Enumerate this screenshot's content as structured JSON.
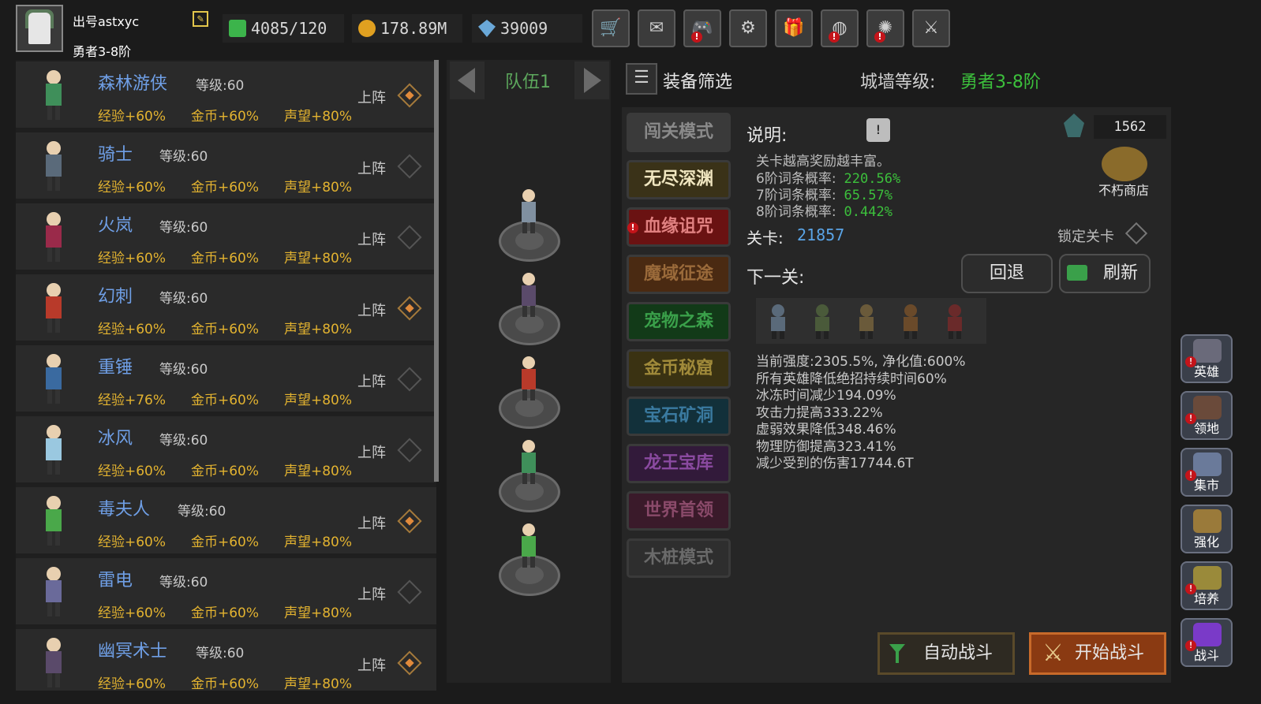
{
  "player": {
    "name": "出号astxyc",
    "rank": "勇者3-8阶"
  },
  "resources": {
    "stamina": "4085/120",
    "gold": "178.89M",
    "diamond": "39009"
  },
  "toolbar": [
    {
      "icon": "shop-cart-icon",
      "glyph": "🛒",
      "alert": false
    },
    {
      "icon": "mail-icon",
      "glyph": "✉",
      "alert": false
    },
    {
      "icon": "gamepad-icon",
      "glyph": "🎮",
      "alert": true
    },
    {
      "icon": "gear-icon",
      "glyph": "⚙",
      "alert": false
    },
    {
      "icon": "gift-icon",
      "glyph": "🎁",
      "alert": false
    },
    {
      "icon": "lottery-wheel-icon",
      "glyph": "◍",
      "alert": true
    },
    {
      "icon": "firework-icon",
      "glyph": "✺",
      "alert": true
    },
    {
      "icon": "crossed-swords-icon",
      "glyph": "⚔",
      "alert": false
    }
  ],
  "heroes": [
    {
      "name": "森林游侠",
      "level": "等级:60",
      "exp": "经验+60%",
      "gold": "金币+60%",
      "fame": "声望+80%",
      "deploy": "上阵",
      "deployed": true,
      "color": "#3f8f5a"
    },
    {
      "name": "骑士",
      "level": "等级:60",
      "exp": "经验+60%",
      "gold": "金币+60%",
      "fame": "声望+80%",
      "deploy": "上阵",
      "deployed": false,
      "color": "#5a6a7a"
    },
    {
      "name": "火岚",
      "level": "等级:60",
      "exp": "经验+60%",
      "gold": "金币+60%",
      "fame": "声望+80%",
      "deploy": "上阵",
      "deployed": false,
      "color": "#9a2a4a"
    },
    {
      "name": "幻刺",
      "level": "等级:60",
      "exp": "经验+60%",
      "gold": "金币+60%",
      "fame": "声望+80%",
      "deploy": "上阵",
      "deployed": true,
      "color": "#b83a2a"
    },
    {
      "name": "重锤",
      "level": "等级:60",
      "exp": "经验+76%",
      "gold": "金币+60%",
      "fame": "声望+80%",
      "deploy": "上阵",
      "deployed": false,
      "color": "#3a6aa0"
    },
    {
      "name": "冰风",
      "level": "等级:60",
      "exp": "经验+60%",
      "gold": "金币+60%",
      "fame": "声望+80%",
      "deploy": "上阵",
      "deployed": false,
      "color": "#9ac8e0"
    },
    {
      "name": "毒夫人",
      "level": "等级:60",
      "exp": "经验+60%",
      "gold": "金币+60%",
      "fame": "声望+80%",
      "deploy": "上阵",
      "deployed": true,
      "color": "#4aa84a"
    },
    {
      "name": "雷电",
      "level": "等级:60",
      "exp": "经验+60%",
      "gold": "金币+60%",
      "fame": "声望+80%",
      "deploy": "上阵",
      "deployed": false,
      "color": "#6a6a9a"
    },
    {
      "name": "幽冥术士",
      "level": "等级:60",
      "exp": "经验+60%",
      "gold": "金币+60%",
      "fame": "声望+80%",
      "deploy": "上阵",
      "deployed": true,
      "color": "#5a4a6a"
    }
  ],
  "team": {
    "label": "队伍1",
    "members": [
      "#8090a0",
      "#5a4a6a",
      "#b83a2a",
      "#3f8f5a",
      "#4aa84a"
    ]
  },
  "filter": {
    "label": "装备筛选"
  },
  "wall": {
    "label": "城墙等级:",
    "value": "勇者3-8阶"
  },
  "modes": [
    {
      "label": "闯关模式",
      "bg": "#3a3a3a",
      "fg": "#8a8a8a",
      "alert": false
    },
    {
      "label": "无尽深渊",
      "bg": "#3a3218",
      "fg": "#f0e6c0",
      "alert": false
    },
    {
      "label": "血缘诅咒",
      "bg": "#6a1212",
      "fg": "#e08080",
      "alert": true
    },
    {
      "label": "魔域征途",
      "bg": "#4a2a12",
      "fg": "#9a6a3a",
      "alert": false
    },
    {
      "label": "宠物之森",
      "bg": "#123a18",
      "fg": "#3aa04a",
      "alert": false
    },
    {
      "label": "金币秘窟",
      "bg": "#3a3212",
      "fg": "#a08a3a",
      "alert": false
    },
    {
      "label": "宝石矿洞",
      "bg": "#12303a",
      "fg": "#3a7aa0",
      "alert": false
    },
    {
      "label": "龙王宝库",
      "bg": "#321a3a",
      "fg": "#8a4aa0",
      "alert": false
    },
    {
      "label": "世界首领",
      "bg": "#3a1a2a",
      "fg": "#8a4a6a",
      "alert": false
    },
    {
      "label": "木桩模式",
      "bg": "#2e2e2e",
      "fg": "#6a6a6a",
      "alert": false
    }
  ],
  "description": {
    "title": "说明:",
    "text": "关卡越高奖励越丰富。",
    "rates": [
      {
        "label": "6阶词条概率:",
        "value": "220.56%"
      },
      {
        "label": "7阶词条概率:",
        "value": "65.57%"
      },
      {
        "label": "8阶词条概率:",
        "value": "0.442%"
      }
    ]
  },
  "shop": {
    "count": "1562",
    "label": "不朽商店"
  },
  "level": {
    "label": "关卡:",
    "value": "21857",
    "lock_label": "锁定关卡"
  },
  "next": {
    "label": "下一关:",
    "back_label": "回退",
    "refresh_label": "刷新"
  },
  "enemies": [
    "#5a6a7a",
    "#4a5a3a",
    "#6a5a3a",
    "#6a4a2a",
    "#6a2a2a"
  ],
  "stats": [
    "当前强度:2305.5%, 净化值:600%",
    "所有英雄降低绝招持续时间60%",
    "冰冻时间减少194.09%",
    "攻击力提高333.22%",
    "虚弱效果降低348.46%",
    "物理防御提高323.41%",
    "减少受到的伤害17744.6T"
  ],
  "battle": {
    "auto_label": "自动战斗",
    "start_label": "开始战斗"
  },
  "side_nav": [
    {
      "label": "英雄",
      "icon": "hero-helmet-icon",
      "alert": true,
      "color": "#6a6a7a"
    },
    {
      "label": "领地",
      "icon": "castle-icon",
      "alert": true,
      "color": "#6a4a3a"
    },
    {
      "label": "集市",
      "icon": "market-icon",
      "alert": true,
      "color": "#6a7a9a"
    },
    {
      "label": "强化",
      "icon": "enhance-icon",
      "alert": false,
      "color": "#9a7a3a"
    },
    {
      "label": "培养",
      "icon": "cultivate-icon",
      "alert": true,
      "color": "#9a8a3a"
    },
    {
      "label": "战斗",
      "icon": "portal-icon",
      "alert": true,
      "color": "#7a3ac8"
    }
  ]
}
